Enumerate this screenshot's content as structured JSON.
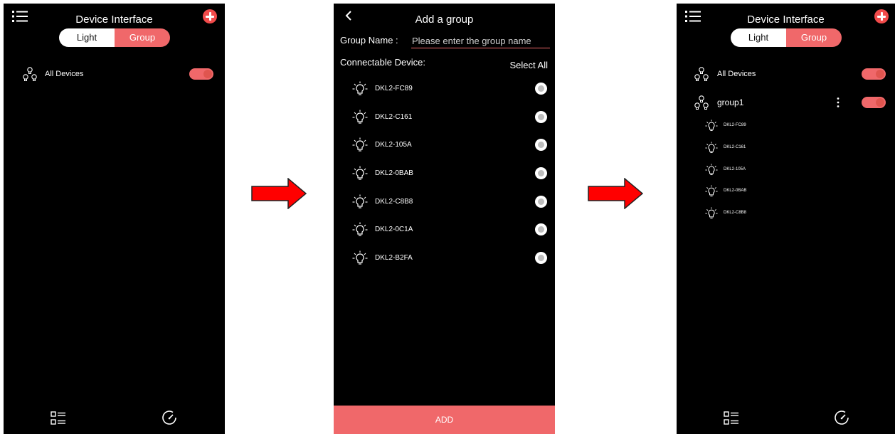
{
  "colors": {
    "accent": "#f0686a",
    "background": "#000000",
    "arrow": "#ff0000"
  },
  "screen1": {
    "title": "Device Interface",
    "segment": {
      "light": "Light",
      "group": "Group"
    },
    "rows": [
      {
        "label": "All Devices"
      }
    ]
  },
  "screen2": {
    "title": "Add a group",
    "group_name_label": "Group Name :",
    "group_name_placeholder": "Please enter the group name",
    "connectable_label": "Connectable Device:",
    "select_all": "Select All",
    "devices": [
      "DKL2-FC89",
      "DKL2-C161",
      "DKL2-105A",
      "DKL2-0BAB",
      "DKL2-C8B8",
      "DKL2-0C1A",
      "DKL2-B2FA"
    ],
    "add_button": "ADD"
  },
  "screen3": {
    "title": "Device Interface",
    "segment": {
      "light": "Light",
      "group": "Group"
    },
    "all_devices": "All Devices",
    "group_name": "group1",
    "group_devices": [
      "DKL2-FC89",
      "DKL2-C161",
      "DKL2-105A",
      "DKL2-0BAB",
      "DKL2-C8B8"
    ]
  },
  "icons": [
    "menu-icon",
    "plus-icon",
    "group-bulbs-icon",
    "bulb-icon",
    "list-icon",
    "gauge-icon",
    "back-icon",
    "more-vertical-icon",
    "right-arrow-icon"
  ]
}
